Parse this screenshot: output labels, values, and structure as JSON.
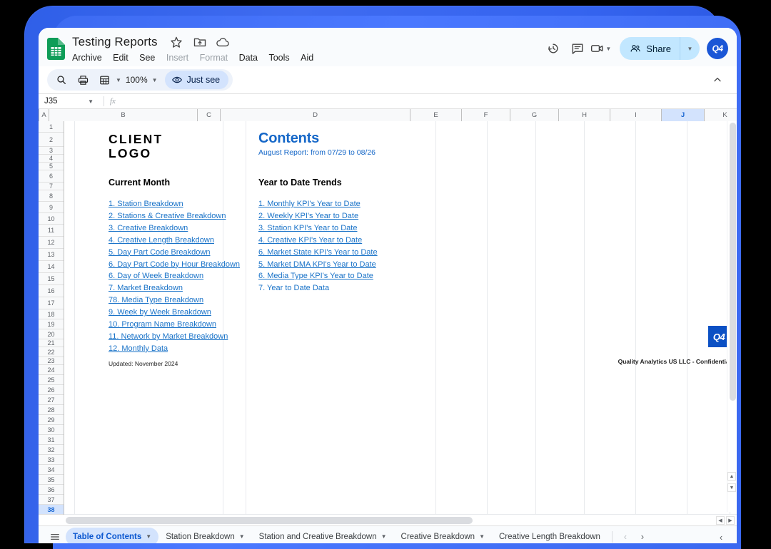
{
  "app": {
    "doc_title": "Testing Reports",
    "title_icons": [
      "star-icon",
      "move-to-folder-icon",
      "cloud-saved-icon"
    ],
    "menus": [
      {
        "label": "Archive",
        "dim": false
      },
      {
        "label": "Edit",
        "dim": false
      },
      {
        "label": "See",
        "dim": false
      },
      {
        "label": "Insert",
        "dim": true
      },
      {
        "label": "Format",
        "dim": true
      },
      {
        "label": "Data",
        "dim": false
      },
      {
        "label": "Tools",
        "dim": false
      },
      {
        "label": "Aid",
        "dim": false
      }
    ],
    "header_right": {
      "history_icon": "version-history-icon",
      "comment_icon": "comment-icon",
      "meet_icon": "video-camera-icon",
      "share_label": "Share",
      "avatar_label": "Q4"
    }
  },
  "toolbar": {
    "search_icon": "search-icon",
    "print_icon": "print-icon",
    "filter_icon": "filter-view-icon",
    "zoom_level": "100%",
    "view_mode_label": "Just see",
    "eye_icon": "eye-icon",
    "collapse_icon": "chevron-up-icon"
  },
  "formula_bar": {
    "name_box": "J35",
    "fx_label": "fx",
    "formula_value": ""
  },
  "grid": {
    "columns": [
      "A",
      "B",
      "C",
      "D",
      "E",
      "F",
      "G",
      "H",
      "I",
      "J",
      "K"
    ],
    "selected_column": "J",
    "selected_row": "38",
    "rows": [
      "1",
      "2",
      "3",
      "4",
      "5",
      "6",
      "7",
      "8",
      "9",
      "10",
      "11",
      "12",
      "13",
      "14",
      "15",
      "16",
      "17",
      "18",
      "19",
      "20",
      "21",
      "22",
      "23",
      "24",
      "25",
      "26",
      "27",
      "28",
      "29",
      "30",
      "31",
      "32",
      "33",
      "34",
      "35",
      "36",
      "37",
      "38"
    ]
  },
  "sheet_content": {
    "client_logo_line1": "CLIENT",
    "client_logo_line2": "LOGO",
    "contents_heading": "Contents",
    "contents_subtitle": "August Report: from 07/29 to 08/26",
    "left_section_heading": "Current Month",
    "right_section_heading": "Year  to Date Trends",
    "left_links": [
      "1. Station Breakdown",
      "2. Stations & Creative Breakdown",
      "3. Creative Breakdown",
      "4. Creative Length Breakdown",
      "5. Day Part Code Breakdown",
      "6. Day Part Code by Hour Breakdown",
      "6. Day of Week Breakdown",
      "7. Market Breakdown",
      "78. Media Type Breakdown",
      "9. Week by Week Breakdown",
      "10. Program Name Breakdown",
      "11. Network by Market Breakdown",
      "12. Monthly Data"
    ],
    "right_links": [
      "1. Monthly KPI's Year to Date",
      "2. Weekly KPI's Year to Date",
      "3. Station KPI's Year to Date",
      "4. Creative KPI's Year to Date",
      "6. Market State  KPI's Year to Date",
      "5. Market DMA  KPI's Year to Date",
      "6. Media Type KPI's Year to Date",
      "7. Year to Date Data"
    ],
    "updated_note": "Updated: November 2024",
    "badge_label": "Q4",
    "confidential_note": "Quality Analytics US LLC - Confidential"
  },
  "sheet_tabs": {
    "all_sheets_icon": "all-sheets-icon",
    "tabs": [
      {
        "label": "Table of Contents",
        "active": true
      },
      {
        "label": "Station Breakdown",
        "active": false
      },
      {
        "label": "Station and Creative Breakdown",
        "active": false
      },
      {
        "label": "Creative Breakdown",
        "active": false
      },
      {
        "label": "Creative Length Breakdown",
        "active": false
      }
    ],
    "prev_icon": "chevron-left-icon",
    "next_icon": "chevron-right-icon",
    "overflow_icon": "chevron-left-icon"
  },
  "colors": {
    "brand_blue": "#1a73e8",
    "device_frame": "#3a68f0",
    "link_blue": "#1a73c8",
    "heading_blue": "#1567c8",
    "badge_blue": "#0b50c4",
    "selection_blue": "#d3e3fd"
  }
}
